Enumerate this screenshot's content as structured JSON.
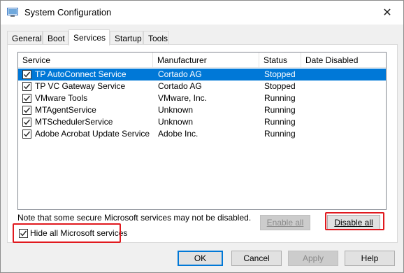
{
  "window": {
    "title": "System Configuration",
    "close_glyph": "✕"
  },
  "tabs": [
    {
      "label": "General"
    },
    {
      "label": "Boot"
    },
    {
      "label": "Services"
    },
    {
      "label": "Startup"
    },
    {
      "label": "Tools"
    }
  ],
  "active_tab": "Services",
  "services": {
    "columns": [
      "Service",
      "Manufacturer",
      "Status",
      "Date Disabled"
    ],
    "rows": [
      {
        "name": "TP AutoConnect Service",
        "manufacturer": "Cortado AG",
        "status": "Stopped",
        "date_disabled": "",
        "checked": true,
        "selected": true
      },
      {
        "name": "TP VC Gateway Service",
        "manufacturer": "Cortado AG",
        "status": "Stopped",
        "date_disabled": "",
        "checked": true,
        "selected": false
      },
      {
        "name": "VMware Tools",
        "manufacturer": "VMware, Inc.",
        "status": "Running",
        "date_disabled": "",
        "checked": true,
        "selected": false
      },
      {
        "name": "MTAgentService",
        "manufacturer": "Unknown",
        "status": "Running",
        "date_disabled": "",
        "checked": true,
        "selected": false
      },
      {
        "name": "MTSchedulerService",
        "manufacturer": "Unknown",
        "status": "Running",
        "date_disabled": "",
        "checked": true,
        "selected": false
      },
      {
        "name": "Adobe Acrobat Update Service",
        "manufacturer": "Adobe Inc.",
        "status": "Running",
        "date_disabled": "",
        "checked": true,
        "selected": false
      }
    ]
  },
  "note": "Note that some secure Microsoft services may not be disabled.",
  "buttons": {
    "enable_all": "Enable all",
    "disable_all": "Disable all",
    "ok": "OK",
    "cancel": "Cancel",
    "apply": "Apply",
    "help": "Help"
  },
  "hide_ms_services": {
    "label": "Hide all Microsoft services",
    "checked": true
  },
  "colors": {
    "selection": "#0078d7",
    "highlight_annotation": "#e0191e"
  },
  "icons": {
    "app": "system-configuration-icon",
    "close": "close-icon",
    "checkbox": "checkmark-icon"
  }
}
